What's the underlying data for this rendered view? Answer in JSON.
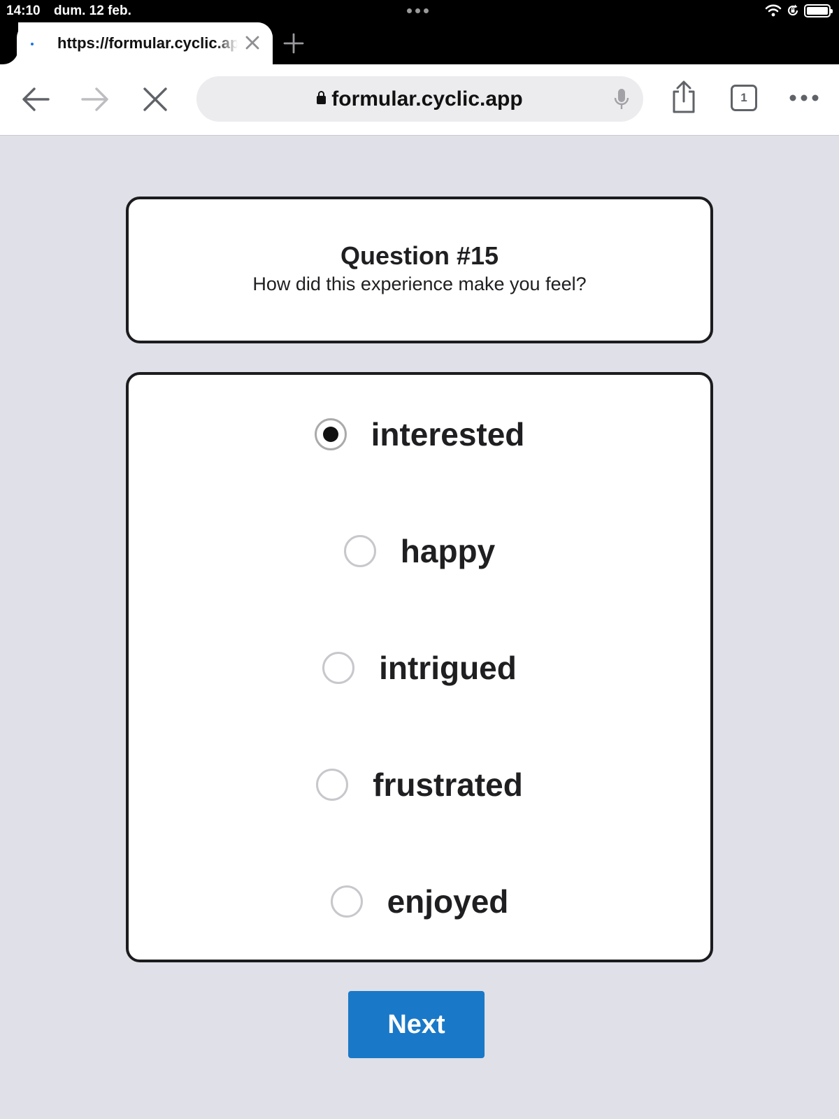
{
  "status_bar": {
    "time": "14:10",
    "date": "dum. 12 feb.",
    "icons": [
      "wifi-icon",
      "orientation-lock-icon",
      "battery-icon"
    ]
  },
  "browser": {
    "tab_title": "https://formular.cyclic.app",
    "address": "formular.cyclic.app",
    "tab_count": "1",
    "icons": [
      "back-arrow-icon",
      "forward-arrow-icon",
      "stop-loading-icon",
      "lock-icon",
      "microphone-icon",
      "share-icon",
      "tabs-icon",
      "more-icon",
      "new-tab-icon",
      "tab-close-icon"
    ]
  },
  "question": {
    "title": "Question #15",
    "text": "How did this experience make you feel?"
  },
  "options": [
    {
      "label": "interested",
      "checked": true
    },
    {
      "label": "happy",
      "checked": false
    },
    {
      "label": "intrigued",
      "checked": false
    },
    {
      "label": "frustrated",
      "checked": false
    },
    {
      "label": "enjoyed",
      "checked": false
    }
  ],
  "next_label": "Next",
  "colors": {
    "page_background": "#dfe0e8",
    "button": "#1a78c8",
    "card_border": "#1c1c1e"
  }
}
